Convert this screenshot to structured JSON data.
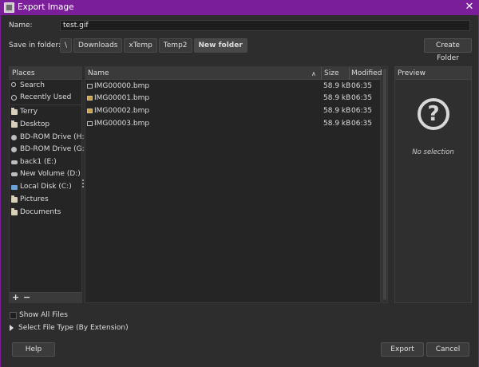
{
  "window": {
    "title": "Export Image"
  },
  "name_label": "Name:",
  "name_value": "test.gif",
  "save_in_label": "Save in folder:",
  "breadcrumbs": [
    "\\",
    "Downloads",
    "xTemp",
    "Temp2",
    "New folder"
  ],
  "create_folder_label": "Create Folder",
  "places": {
    "header": "Places",
    "items": [
      {
        "label": "Search",
        "icon": "search-icon"
      },
      {
        "label": "Recently Used",
        "icon": "recent-icon"
      },
      {
        "label": "Terry",
        "icon": "folder-icon"
      },
      {
        "label": "Desktop",
        "icon": "folder-icon"
      },
      {
        "label": "BD-ROM Drive (H:)",
        "icon": "disc-icon"
      },
      {
        "label": "BD-ROM Drive (G:)",
        "icon": "disc-icon"
      },
      {
        "label": "back1 (E:)",
        "icon": "drive-icon"
      },
      {
        "label": "New Volume (D:)",
        "icon": "drive-icon"
      },
      {
        "label": "Local Disk (C:)",
        "icon": "network-drive-icon"
      },
      {
        "label": "Pictures",
        "icon": "folder-icon"
      },
      {
        "label": "Documents",
        "icon": "folder-icon"
      }
    ],
    "add_label": "+",
    "remove_label": "−"
  },
  "files": {
    "columns": {
      "name": "Name",
      "size": "Size",
      "modified": "Modified"
    },
    "rows": [
      {
        "name": "IMG00000.bmp",
        "size": "58.9 kB",
        "modified": "06:35",
        "icon": "bmp-icon"
      },
      {
        "name": "IMG00001.bmp",
        "size": "58.9 kB",
        "modified": "06:35",
        "icon": "image-icon"
      },
      {
        "name": "IMG00002.bmp",
        "size": "58.9 kB",
        "modified": "06:35",
        "icon": "image-icon"
      },
      {
        "name": "IMG00003.bmp",
        "size": "58.9 kB",
        "modified": "06:35",
        "icon": "bmp-icon"
      }
    ]
  },
  "preview": {
    "header": "Preview",
    "empty_text": "No selection",
    "icon": "question-icon"
  },
  "show_all_files_label": "Show All Files",
  "select_file_type_label": "Select File Type (By Extension)",
  "buttons": {
    "help": "Help",
    "export": "Export",
    "cancel": "Cancel"
  },
  "colors": {
    "titlebar": "#7b1e9a",
    "background": "#2d2d2d"
  }
}
